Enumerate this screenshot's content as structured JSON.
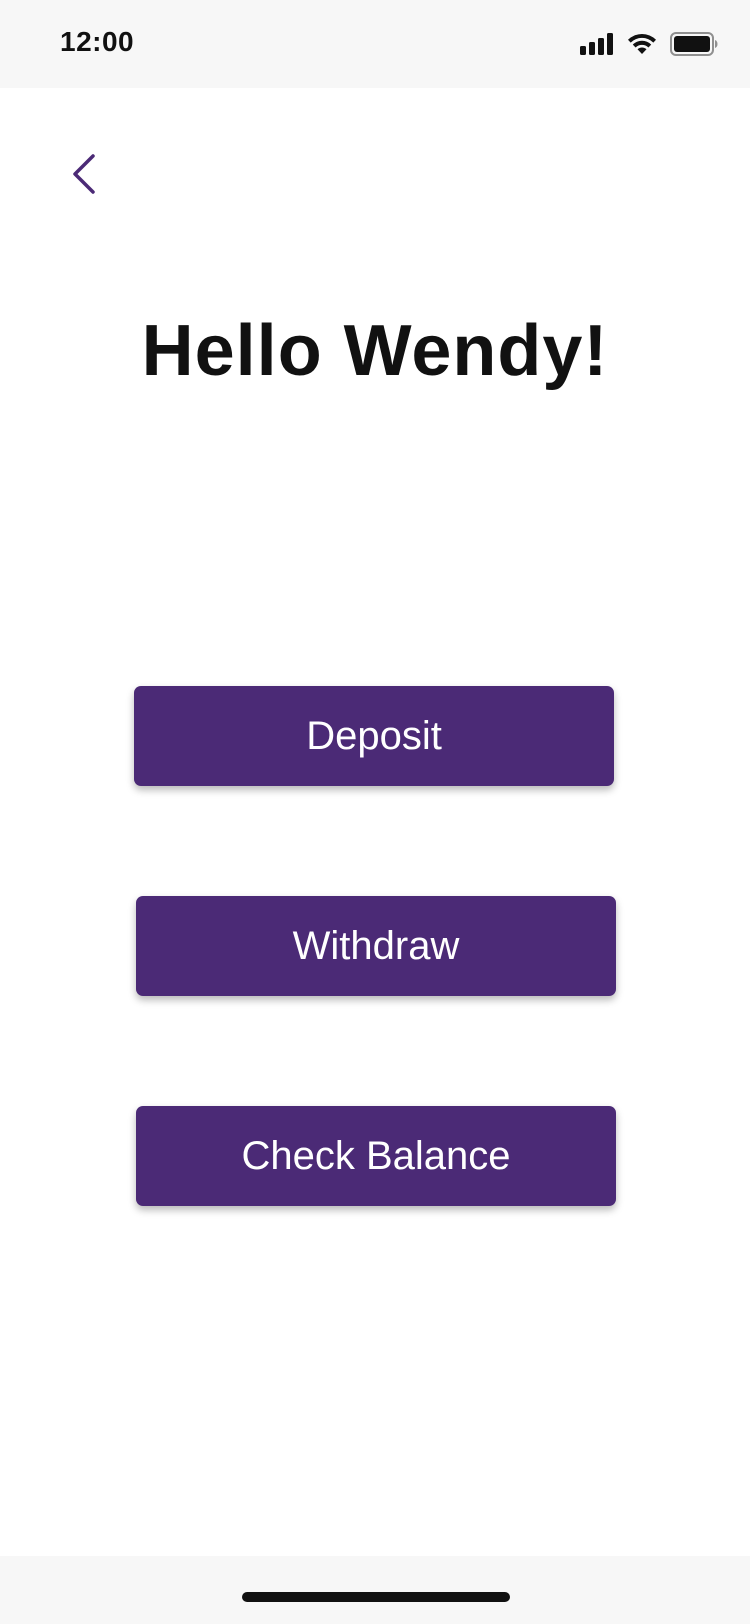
{
  "status_bar": {
    "time": "12:00",
    "icons": [
      "signal-icon",
      "wifi-icon",
      "battery-icon"
    ]
  },
  "nav": {
    "back_icon": "chevron-left-icon"
  },
  "main": {
    "greeting": "Hello Wendy!",
    "buttons": [
      {
        "label": "Deposit"
      },
      {
        "label": "Withdraw"
      },
      {
        "label": "Check Balance"
      }
    ]
  },
  "colors": {
    "accent": "#4b2a76",
    "text": "#111111",
    "bars": "#f7f7f7"
  }
}
